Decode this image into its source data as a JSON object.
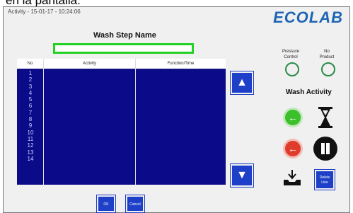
{
  "caption": "en la pantalla.",
  "status": "Activity - 15-01-17 - 10:24:06",
  "logo": "ECOLAB",
  "title": "Wash Step Name",
  "input_value": "",
  "table": {
    "headers": [
      "No",
      "Activity",
      "Function/Time"
    ],
    "rows": [
      "1",
      "2",
      "3",
      "4",
      "5",
      "6",
      "7",
      "8",
      "9",
      "10",
      "11",
      "12",
      "13",
      "14"
    ]
  },
  "indicators": [
    {
      "label_line1": "Pressure",
      "label_line2": "Control"
    },
    {
      "label_line1": "No",
      "label_line2": "Product"
    }
  ],
  "wash_activity": "Wash Activity",
  "buttons": {
    "up": "▲",
    "down": "▼",
    "delete_line1": "Delete",
    "delete_line2": "Line",
    "ok": "OK",
    "cancel": "Cancel"
  }
}
